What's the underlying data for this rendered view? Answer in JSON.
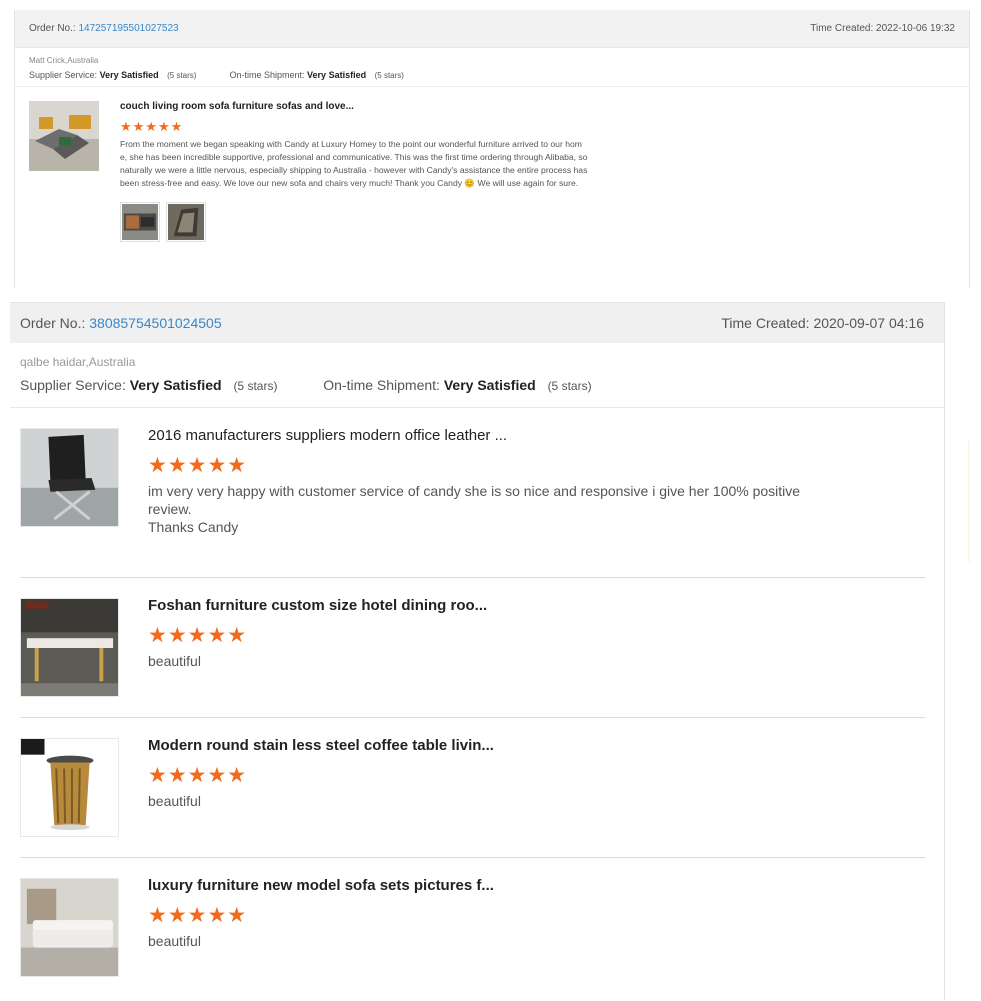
{
  "top_review": {
    "order_label": "Order No.:",
    "order_no": "147257195501027523",
    "time_label": "Time Created:",
    "time_value": "2022-10-06 19:32",
    "buyer": "Matt Crick,Australia",
    "supplier_label": "Supplier Service:",
    "supplier_value": "Very Satisfied",
    "supplier_stars": "(5 stars)",
    "shipment_label": "On-time Shipment:",
    "shipment_value": "Very Satisfied",
    "shipment_stars": "(5 stars)",
    "item": {
      "title": "couch living room sofa furniture sofas and love...",
      "rating": 5,
      "stars_text": "★★★★★",
      "comment": "From the moment we began speaking with Candy at Luxury Homey to the point our wonderful furniture arrived to our home, she has been incredible supportive, professional and communicative. This was the first time ordering through Alibaba, so naturally we were a little nervous, especially shipping to Australia - however with Candy's assistance the entire process has been stress-free and easy. We love our new sofa and chairs very much! Thank you Candy 😊 We will use again for sure."
    }
  },
  "main_review": {
    "order_label": "Order No.:",
    "order_no": "38085754501024505",
    "time_label": "Time Created:",
    "time_value": "2020-09-07 04:16",
    "buyer": "qalbe haidar,Australia",
    "supplier_label": "Supplier Service:",
    "supplier_value": "Very Satisfied",
    "supplier_stars": "(5 stars)",
    "shipment_label": "On-time Shipment:",
    "shipment_value": "Very Satisfied",
    "shipment_stars": "(5 stars)",
    "items": [
      {
        "title": "2016 manufacturers suppliers modern office leather ...",
        "rating": 5,
        "stars_text": "★★★★★",
        "comment": "im very very happy with customer service of candy she is so nice and responsive i give her 100% positive review.",
        "comment2": "Thanks Candy"
      },
      {
        "title": "Foshan furniture custom size hotel dining roo...",
        "rating": 5,
        "stars_text": "★★★★★",
        "comment": "beautiful"
      },
      {
        "title": "Modern round stain less steel coffee table livin...",
        "rating": 5,
        "stars_text": "★★★★★",
        "comment": "beautiful"
      },
      {
        "title": "luxury furniture new model sofa sets pictures f...",
        "rating": 5,
        "stars_text": "★★★★★",
        "comment": "beautiful"
      }
    ]
  },
  "colors": {
    "accent_link": "#3a86c8",
    "star": "#f26a1b"
  }
}
